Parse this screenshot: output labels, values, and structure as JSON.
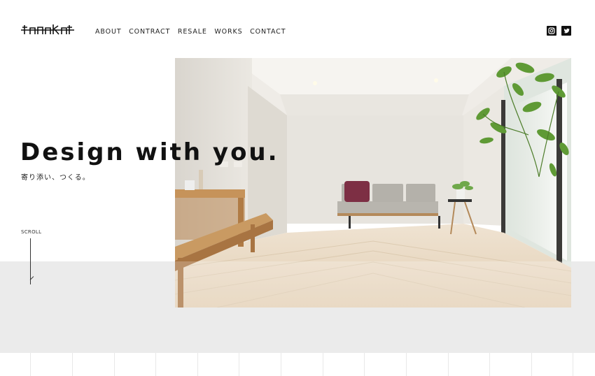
{
  "header": {
    "logo_text": "tanaka",
    "nav": [
      "ABOUT",
      "CONTRACT",
      "RESALE",
      "WORKS",
      "CONTACT"
    ],
    "social": [
      {
        "icon": "instagram-icon"
      },
      {
        "icon": "twitter-icon"
      }
    ]
  },
  "hero": {
    "headline": "Design with you.",
    "subline": "寄り添い、つくる。",
    "image_alt": "Bright living room with herringbone wood floor, grey sofa, wooden bench and plant by the window"
  },
  "scroll": {
    "label": "SCROLL"
  },
  "colors": {
    "text": "#111111",
    "band": "#ebebeb",
    "background": "#ffffff"
  }
}
